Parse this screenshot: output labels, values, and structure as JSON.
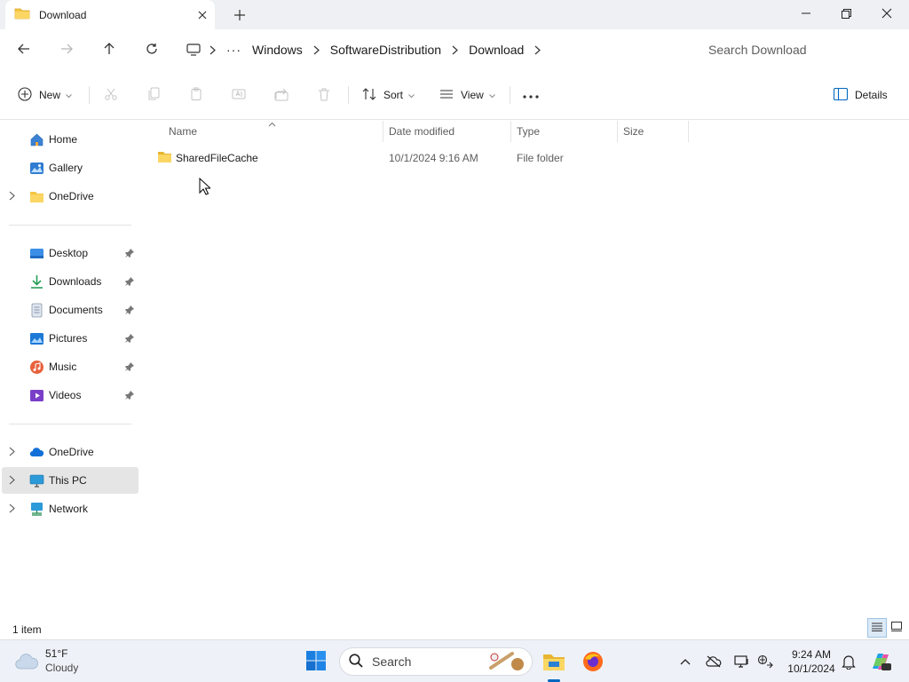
{
  "window": {
    "tab_title": "Download",
    "folder_icon": "folder-icon"
  },
  "address": {
    "breadcrumbs": [
      "Windows",
      "SoftwareDistribution",
      "Download"
    ],
    "search_placeholder": "Search Download"
  },
  "commands": {
    "new_label": "New",
    "sort_label": "Sort",
    "view_label": "View",
    "details_label": "Details"
  },
  "nav": {
    "quick": [
      {
        "label": "Home",
        "icon": "home-icon"
      },
      {
        "label": "Gallery",
        "icon": "gallery-icon"
      },
      {
        "label": "OneDrive",
        "icon": "folder-icon"
      }
    ],
    "pinned": [
      {
        "label": "Desktop",
        "icon": "desktop-icon"
      },
      {
        "label": "Downloads",
        "icon": "downloads-icon"
      },
      {
        "label": "Documents",
        "icon": "documents-icon"
      },
      {
        "label": "Pictures",
        "icon": "pictures-icon"
      },
      {
        "label": "Music",
        "icon": "music-icon"
      },
      {
        "label": "Videos",
        "icon": "videos-icon"
      }
    ],
    "locations": [
      {
        "label": "OneDrive",
        "icon": "cloud-icon"
      },
      {
        "label": "This PC",
        "icon": "pc-icon"
      },
      {
        "label": "Network",
        "icon": "network-icon"
      }
    ]
  },
  "columns": [
    "Name",
    "Date modified",
    "Type",
    "Size"
  ],
  "files": [
    {
      "name": "SharedFileCache",
      "date": "10/1/2024 9:16 AM",
      "type": "File folder",
      "size": ""
    }
  ],
  "status": {
    "item_count": "1 item"
  },
  "taskbar": {
    "temperature": "51°F",
    "condition": "Cloudy",
    "search_label": "Search",
    "time": "9:24 AM",
    "date": "10/1/2024"
  },
  "colors": {
    "accent": "#0067c0",
    "folder": "#f4c542",
    "selected_nav": "#e5e5e5"
  }
}
